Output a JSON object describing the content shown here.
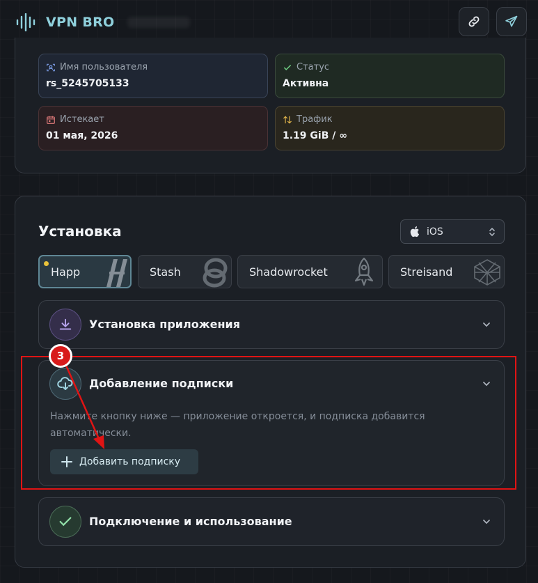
{
  "header": {
    "brand": "VPN BRO"
  },
  "account": {
    "username_label": "Имя пользователя",
    "username_value": "rs_5245705133",
    "status_label": "Статус",
    "status_value": "Активна",
    "expires_label": "Истекает",
    "expires_value": "01 мая, 2026",
    "traffic_label": "Трафик",
    "traffic_value": "1.19 GiB / ∞"
  },
  "install": {
    "title": "Установка",
    "platform": "iOS",
    "apps": [
      {
        "label": "Happ",
        "active": true
      },
      {
        "label": "Stash",
        "active": false
      },
      {
        "label": "Shadowrocket",
        "active": false
      },
      {
        "label": "Streisand",
        "active": false
      }
    ],
    "steps": [
      {
        "title": "Установка приложения"
      },
      {
        "title": "Добавление подписки",
        "description": "Нажмите кнопку ниже — приложение откроется, и подписка добавится автоматически.",
        "button_label": "Добавить подписку"
      },
      {
        "title": "Подключение и использование"
      }
    ]
  },
  "annotation": {
    "step_number": "3"
  },
  "colors": {
    "accent": "#8fd0dc",
    "highlight": "#e01414",
    "active_dot": "#e8c23a"
  }
}
